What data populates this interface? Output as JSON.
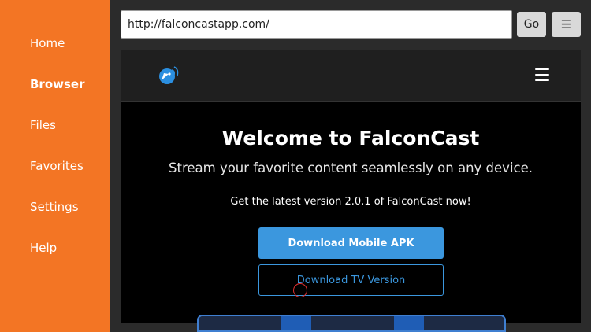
{
  "sidebar": {
    "items": [
      {
        "label": "Home",
        "active": false
      },
      {
        "label": "Browser",
        "active": true
      },
      {
        "label": "Files",
        "active": false
      },
      {
        "label": "Favorites",
        "active": false
      },
      {
        "label": "Settings",
        "active": false
      },
      {
        "label": "Help",
        "active": false
      }
    ]
  },
  "toolbar": {
    "url": "http://falconcastapp.com/",
    "go_label": "Go",
    "menu_icon": "hamburger-icon"
  },
  "site": {
    "logo_icon": "falcon-logo-icon",
    "menu_icon": "hamburger-icon",
    "title": "Welcome to FalconCast",
    "subtitle": "Stream your favorite content seamlessly on any device.",
    "version_note": "Get the latest version 2.0.1 of FalconCast now!",
    "primary_button": "Download Mobile APK",
    "secondary_button": "Download TV Version"
  },
  "colors": {
    "sidebar": "#f37524",
    "accent": "#3b97de",
    "page_bg": "#000000"
  }
}
